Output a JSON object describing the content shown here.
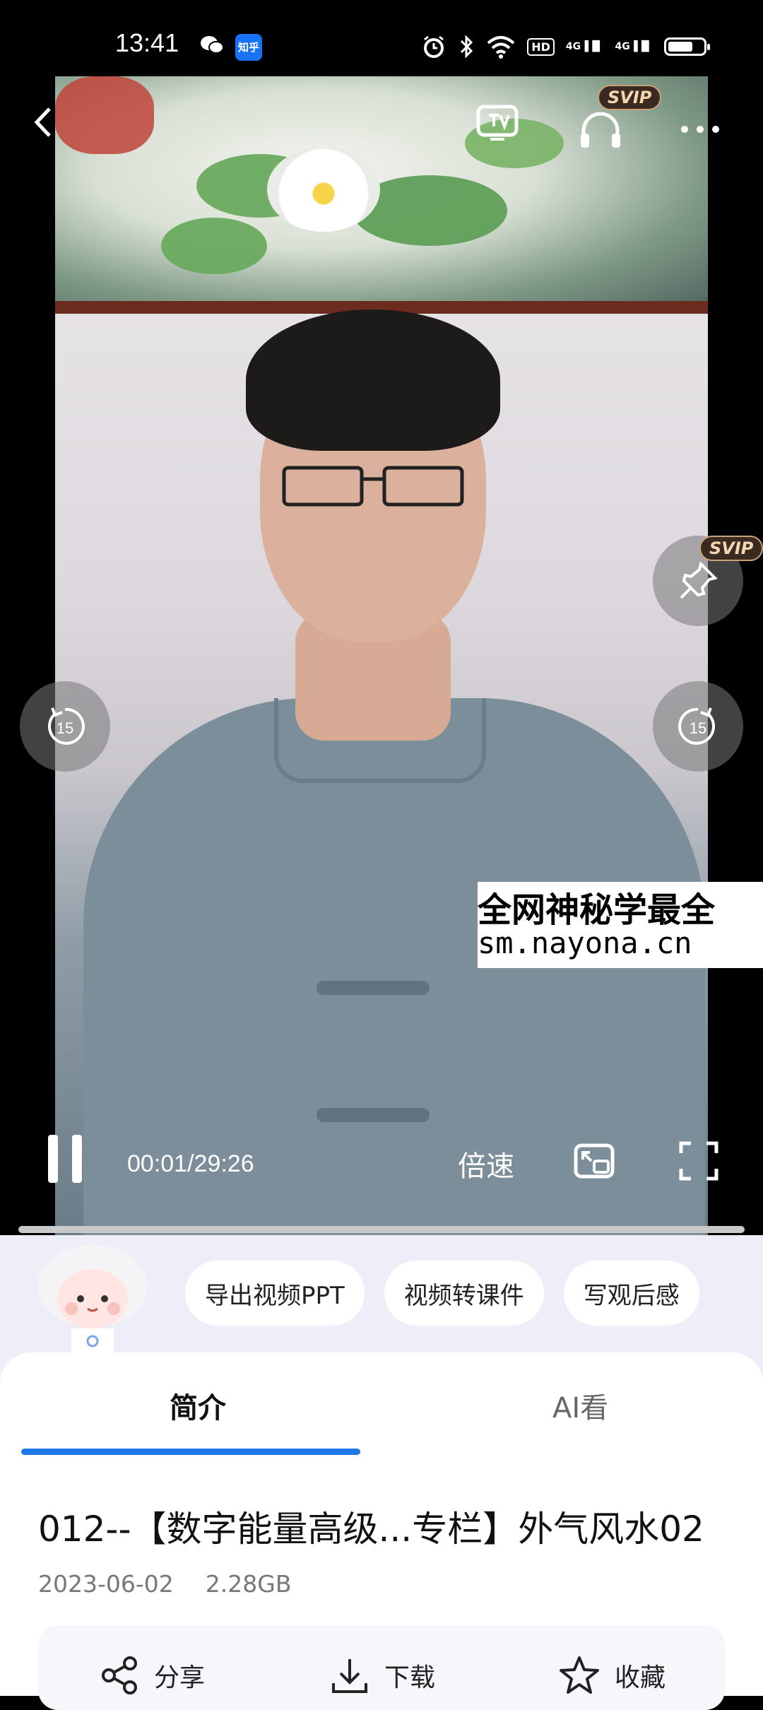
{
  "status_bar": {
    "time": "13:41",
    "zhihu_label": "知乎",
    "hd_label": "HD",
    "signal1_label": "4G",
    "signal2_label": "4G",
    "battery_level": 0.72
  },
  "player": {
    "top_icons": [
      "back-icon",
      "tv-cast-icon",
      "headphones-icon",
      "more-icon"
    ],
    "svip_label": "SVIP",
    "pin_svip_label": "SVIP",
    "rewind_label": "15",
    "forward_label": "15",
    "watermark_line1": "全网神秘学最全",
    "watermark_line2": "sm.nayona.cn",
    "time_display": "00:01/29:26",
    "speed_label": "倍速",
    "progress": 0.0006
  },
  "ai_chips": [
    "导出视频PPT",
    "视频转课件",
    "写观后感"
  ],
  "tabs": {
    "intro": "简介",
    "ai": "AI看"
  },
  "video_info": {
    "title": "012--【数字能量高级...专栏】外气风水02",
    "date": "2023-06-02",
    "size": "2.28GB"
  },
  "actions": {
    "share": "分享",
    "download": "下载",
    "favorite": "收藏"
  },
  "colors": {
    "accent": "#1e78e6",
    "panel_bg": "#edeef7",
    "svip_gold": "#f3d6b0"
  }
}
